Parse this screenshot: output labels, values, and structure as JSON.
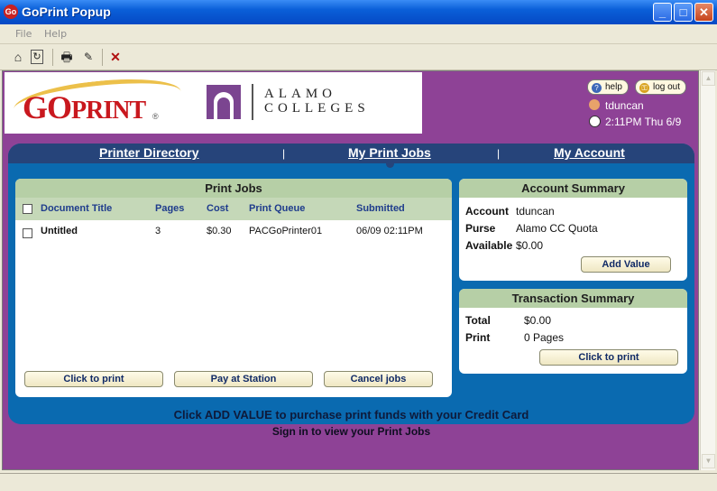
{
  "window": {
    "title": "GoPrint Popup",
    "app_icon": "Go"
  },
  "menu": {
    "file": "File",
    "help": "Help"
  },
  "toolbar_icons": [
    "home-icon",
    "refresh-icon",
    "print-icon",
    "edit-icon",
    "close-x-icon"
  ],
  "header": {
    "logo_text_go": "GO",
    "logo_text_print": "PRINT",
    "logo_mark": "®",
    "college_line1": "ALAMO",
    "college_line2": "COLLEGES",
    "help_label": "help",
    "logout_label": "log out",
    "username": "tduncan",
    "time": "2:11PM Thu 6/9"
  },
  "nav": {
    "printer_directory": "Printer Directory",
    "my_print_jobs": "My Print Jobs",
    "my_account": "My Account",
    "separator": "|"
  },
  "print_jobs": {
    "title": "Print Jobs",
    "columns": [
      "Document Title",
      "Pages",
      "Cost",
      "Print Queue",
      "Submitted"
    ],
    "rows": [
      {
        "document": "Untitled",
        "pages": "3",
        "cost": "$0.30",
        "queue": "PACGoPrinter01",
        "submitted": "06/09 02:11PM"
      }
    ],
    "buttons": {
      "click_to_print": "Click to print",
      "pay_at_station": "Pay at Station",
      "cancel_jobs": "Cancel jobs"
    }
  },
  "account_summary": {
    "title": "Account Summary",
    "account_label": "Account",
    "account_value": "tduncan",
    "purse_label": "Purse",
    "purse_value": "Alamo CC Quota",
    "available_label": "Available",
    "available_value": "$0.00",
    "add_value_button": "Add Value"
  },
  "transaction_summary": {
    "title": "Transaction Summary",
    "total_label": "Total",
    "total_value": "$0.00",
    "print_label": "Print",
    "print_value": "0 Pages",
    "click_to_print_button": "Click to print"
  },
  "messages": {
    "line1": "Click ADD VALUE to purchase print funds with your Credit Card",
    "line2": "Sign in to view your Print Jobs"
  },
  "colors": {
    "background": "#8e4296",
    "panel": "#0a6ab0",
    "navbar": "#26447a",
    "card_header": "#b6cfa6"
  }
}
